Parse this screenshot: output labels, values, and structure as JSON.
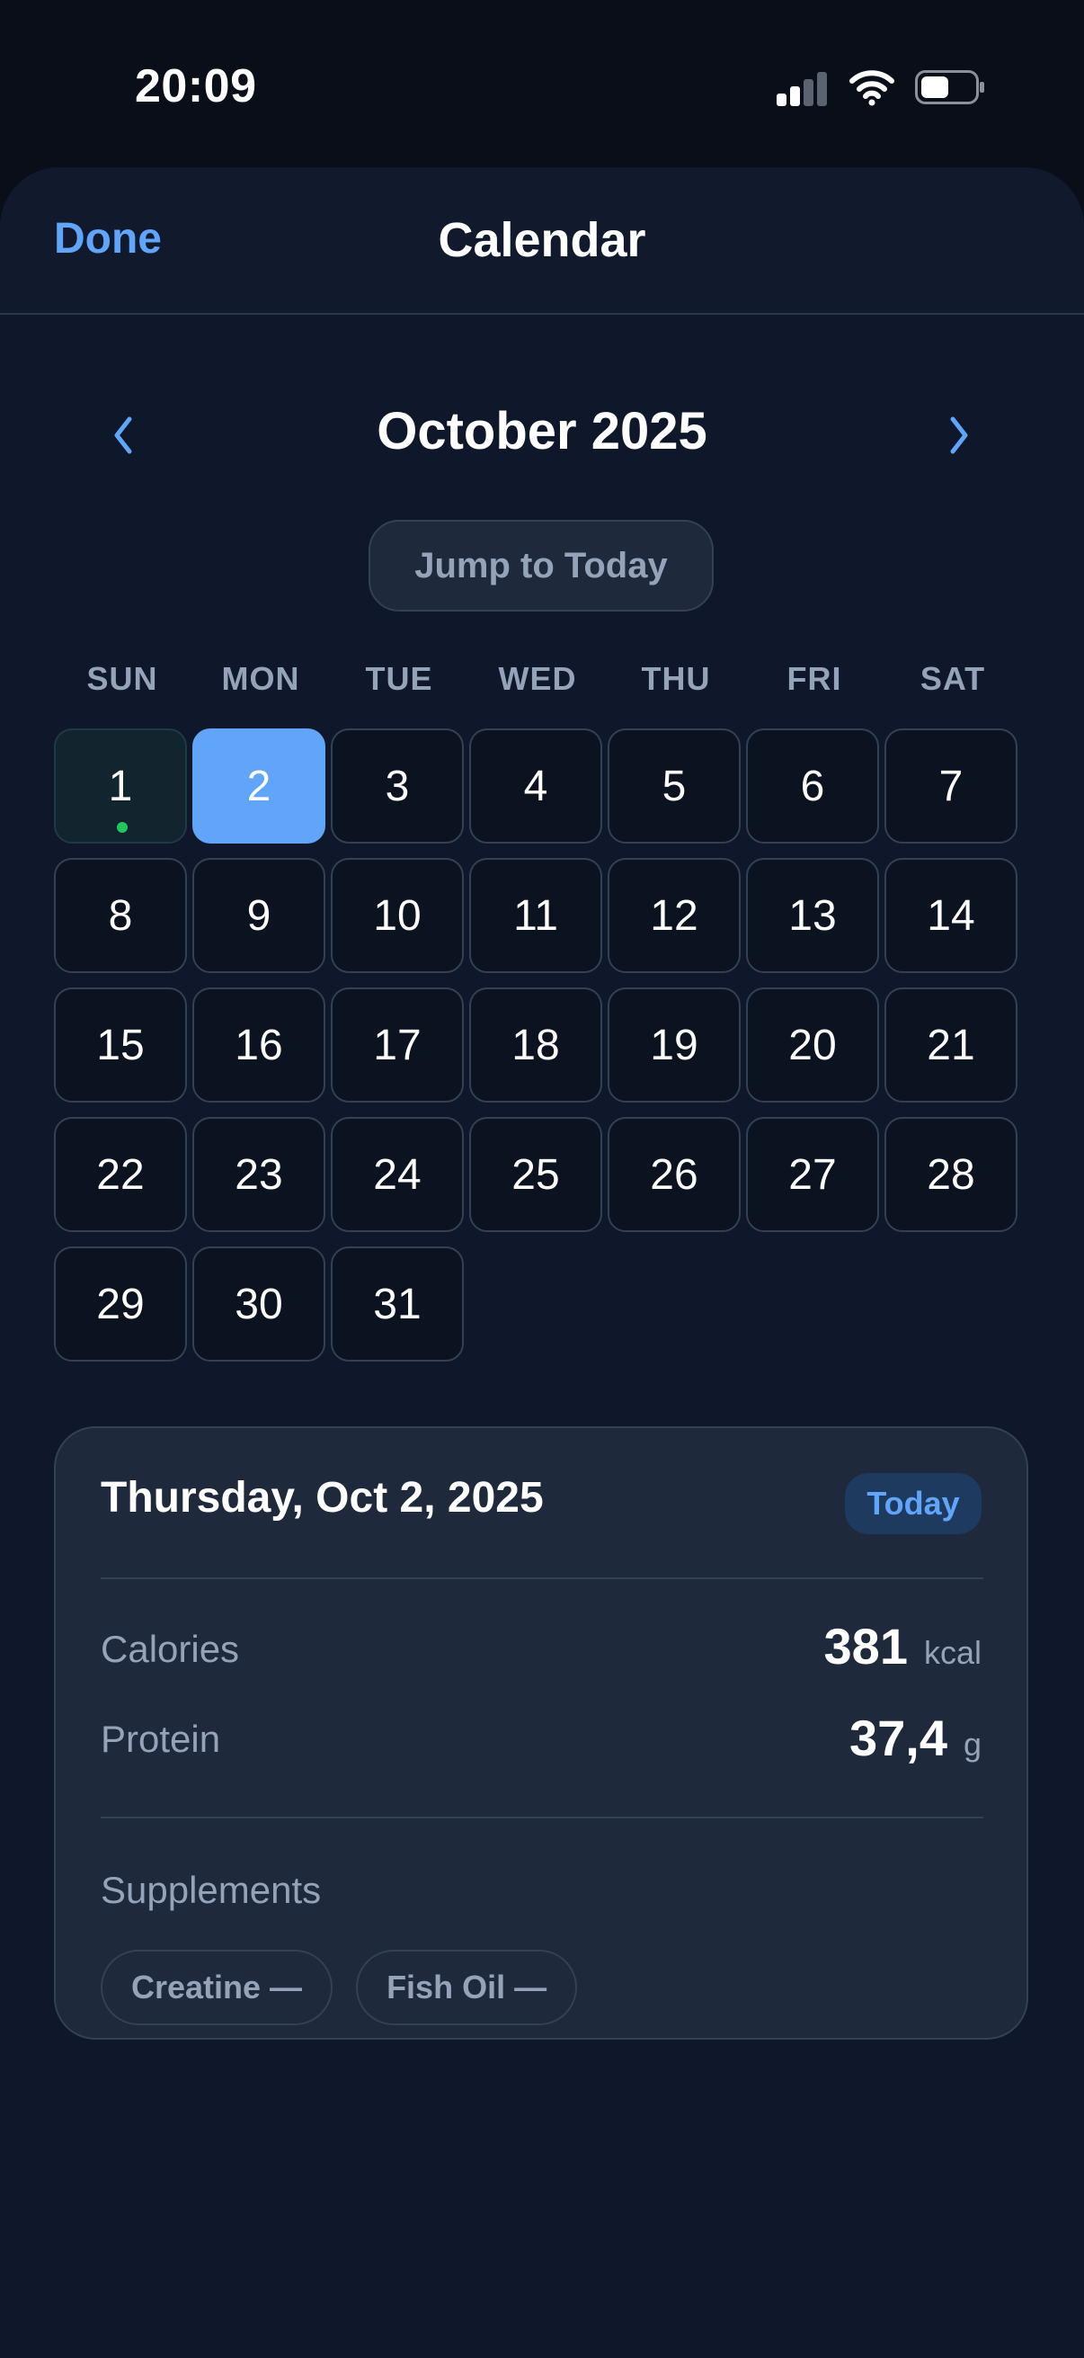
{
  "status": {
    "time": "20:09"
  },
  "nav": {
    "done": "Done",
    "title": "Calendar"
  },
  "month": {
    "title": "October 2025",
    "prev_icon": "chevron-left-icon",
    "next_icon": "chevron-right-icon"
  },
  "jump_today": "Jump to Today",
  "weekdays": [
    "SUN",
    "MON",
    "TUE",
    "WED",
    "THU",
    "FRI",
    "SAT"
  ],
  "days": [
    "1",
    "2",
    "3",
    "4",
    "5",
    "6",
    "7",
    "8",
    "9",
    "10",
    "11",
    "12",
    "13",
    "14",
    "15",
    "16",
    "17",
    "18",
    "19",
    "20",
    "21",
    "22",
    "23",
    "24",
    "25",
    "26",
    "27",
    "28",
    "29",
    "30",
    "31"
  ],
  "selected_day": "2",
  "logged_day": "1",
  "detail": {
    "date": "Thursday, Oct 2, 2025",
    "badge": "Today",
    "calories": {
      "label": "Calories",
      "value": "381",
      "unit": "kcal"
    },
    "protein": {
      "label": "Protein",
      "value": "37,4",
      "unit": "g"
    },
    "supplements_label": "Supplements",
    "supplements": [
      "Creatine —",
      "Fish Oil —"
    ]
  },
  "colors": {
    "accent": "#60a5fa",
    "logged_dot": "#22c55e",
    "background": "#0f172a"
  }
}
